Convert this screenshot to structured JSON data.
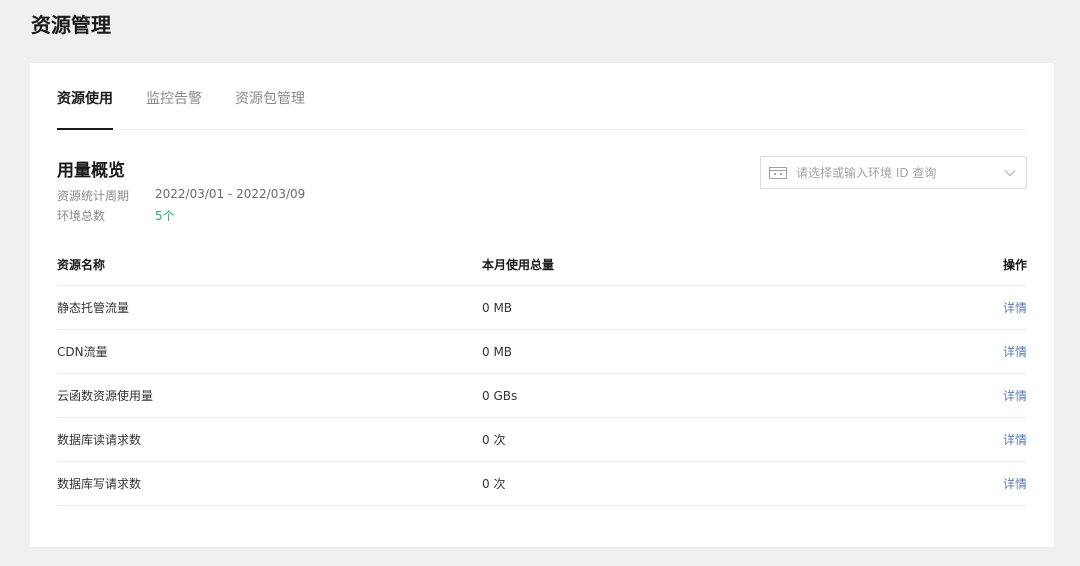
{
  "page": {
    "title": "资源管理"
  },
  "tabs": [
    {
      "label": "资源使用",
      "active": true
    },
    {
      "label": "监控告警",
      "active": false
    },
    {
      "label": "资源包管理",
      "active": false
    }
  ],
  "overview": {
    "title": "用量概览",
    "period_label": "资源统计周期",
    "period_value": "2022/03/01 - 2022/03/09",
    "env_count_label": "环境总数",
    "env_count_value": "5个"
  },
  "env_select": {
    "placeholder": "请选择或输入环境 ID 查询",
    "value": "",
    "icon": "environment-icon"
  },
  "table": {
    "headers": [
      "资源名称",
      "本月使用总量",
      "操作"
    ],
    "rows": [
      {
        "name": "静态托管流量",
        "usage": "0 MB",
        "action": "详情"
      },
      {
        "name": "CDN流量",
        "usage": "0 MB",
        "action": "详情"
      },
      {
        "name": "云函数资源使用量",
        "usage": "0 GBs",
        "action": "详情"
      },
      {
        "name": "数据库读请求数",
        "usage": "0 次",
        "action": "详情"
      },
      {
        "name": "数据库写请求数",
        "usage": "0 次",
        "action": "详情"
      }
    ]
  },
  "colors": {
    "background": "#f0f0f0",
    "card": "#ffffff",
    "accent_link": "#5b7bb3",
    "green": "#22b35e"
  }
}
